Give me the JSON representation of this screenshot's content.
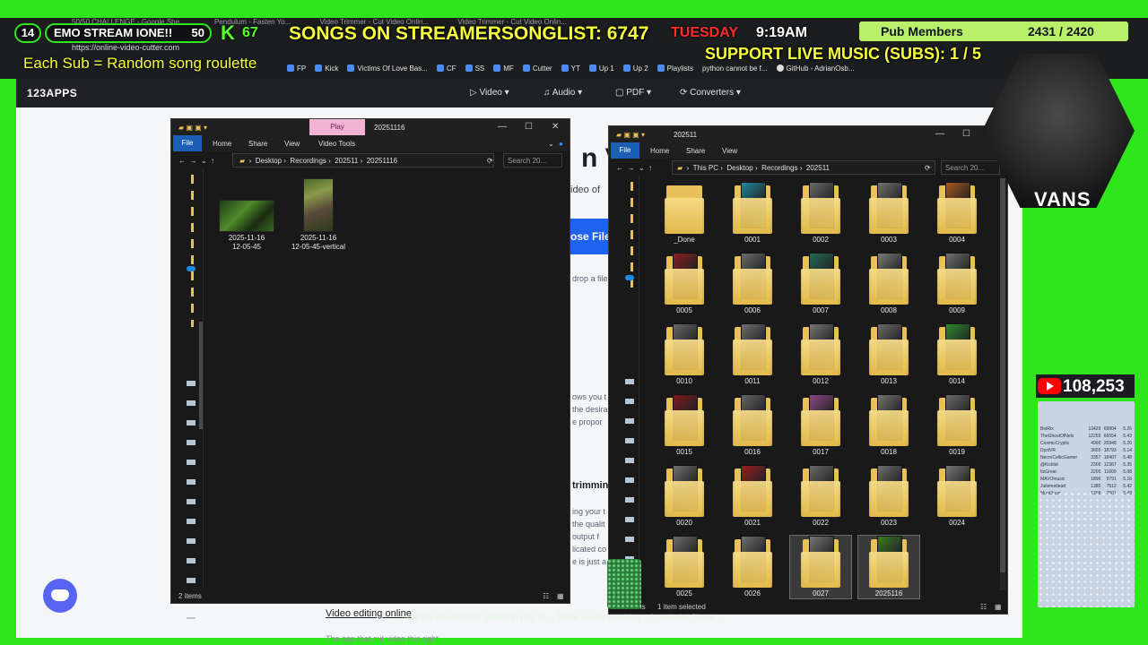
{
  "overlay": {
    "tabs": [
      "50/50 CHALLENGE - Google She...",
      "Pendulum - Fasten Yo...",
      "Video Trimmer - Cut Video Onlin...",
      "Video Trimmer - Cut Video Onlin..."
    ],
    "url": "https://online-video-cutter.com",
    "left_badge_num": "14",
    "emo_badge": "EMO STREAM IONE!!",
    "right_badge_num": "50",
    "kick_count": "67",
    "songs_text": "SONGS ON STREAMERSONGLIST: 6747",
    "day_text": "TUESDAY",
    "time_text": "9:19AM",
    "pub_label": "Pub Members",
    "pub_count": "2431 / 2420",
    "support_text": "SUPPORT LIVE MUSIC (SUBS): 1 / 5",
    "sub_banner": "Each Sub = Random song roulette",
    "bookmarks": [
      "FP",
      "Kick",
      "Victims Of Love Bas...",
      "CF",
      "SS",
      "MF",
      "Cutter",
      "YT",
      "Up 1",
      "Up 2",
      "Playlists",
      "python cannot be f...",
      "GitHub - AdrianOsb..."
    ],
    "yt_count": "108,253",
    "cam_brand": "VANS",
    "ticker": "...have the winner list for playlist to play :D ... Thank you for watching ... I can help! Check ..."
  },
  "webpage": {
    "logo": "123APPS",
    "nav": [
      {
        "label": "Video",
        "icon": "video-icon"
      },
      {
        "label": "Audio",
        "icon": "music-note-icon"
      },
      {
        "label": "PDF",
        "icon": "document-icon"
      },
      {
        "label": "Converters",
        "icon": "refresh-icon"
      }
    ],
    "choose_btn": "ose File",
    "hero_fragment": "n Vi",
    "sub_fragment": "ideo of",
    "drop_fragment": "drop a file",
    "para_fragments": [
      "ows you t",
      "the desira",
      "e propor"
    ],
    "section_fragment": "trimmin",
    "section_lines": [
      "ing your t",
      "the qualit",
      "output f",
      "licated co",
      "e is just a"
    ],
    "tagline": "Video editing online",
    "tagline_sub": "The app that cut video this right"
  },
  "left_window": {
    "play_tab": "Play",
    "title": "20251116",
    "ribbon": [
      "File",
      "Home",
      "Share",
      "View",
      "Video Tools"
    ],
    "path": [
      "Desktop",
      "Recordings",
      "202511",
      "20251116"
    ],
    "search_placeholder": "Search 20...",
    "items": [
      {
        "label": "2025-11-16\n12-05-45",
        "kind": "video-h"
      },
      {
        "label": "2025-11-16\n12-05-45-vertical",
        "kind": "video-v"
      }
    ],
    "status": "2 items"
  },
  "right_window": {
    "title": "202511",
    "ribbon": [
      "File",
      "Home",
      "Share",
      "View"
    ],
    "path": [
      "This PC",
      "Desktop",
      "Recordings",
      "202511"
    ],
    "search_placeholder": "Search 20...",
    "status_left": "ms",
    "status": "1 item selected",
    "folders": [
      {
        "label": "_Done",
        "color": ""
      },
      {
        "label": "0001",
        "color": "#1e8a9a"
      },
      {
        "label": "0002",
        "color": "#6a6a6a"
      },
      {
        "label": "0003",
        "color": "#737373"
      },
      {
        "label": "0004",
        "color": "#a8591f"
      },
      {
        "label": "0005",
        "color": "#8a1e22"
      },
      {
        "label": "0006",
        "color": "#6d6d6d"
      },
      {
        "label": "0007",
        "color": "#1f6d55"
      },
      {
        "label": "0008",
        "color": "#7c7c7c"
      },
      {
        "label": "0009",
        "color": "#707070"
      },
      {
        "label": "0010",
        "color": "#686868"
      },
      {
        "label": "0011",
        "color": "#6f6f6f"
      },
      {
        "label": "0012",
        "color": "#777777"
      },
      {
        "label": "0013",
        "color": "#6a6a6a"
      },
      {
        "label": "0014",
        "color": "#2d8a2f"
      },
      {
        "label": "0015",
        "color": "#7d1a1f"
      },
      {
        "label": "0016",
        "color": "#666666"
      },
      {
        "label": "0017",
        "color": "#8e4a8a"
      },
      {
        "label": "0018",
        "color": "#747474"
      },
      {
        "label": "0019",
        "color": "#6b6b6b"
      },
      {
        "label": "0020",
        "color": "#707070"
      },
      {
        "label": "0021",
        "color": "#9a1b20"
      },
      {
        "label": "0022",
        "color": "#6b6b6b"
      },
      {
        "label": "0023",
        "color": "#6e6e6e"
      },
      {
        "label": "0024",
        "color": "#767676"
      },
      {
        "label": "0025",
        "color": "#6c6c6c"
      },
      {
        "label": "0026",
        "color": "#707070"
      },
      {
        "label": "0027",
        "color": "#777777"
      },
      {
        "label": "2025116",
        "color": "#3c7a25"
      }
    ],
    "selected_index": 28,
    "hover_index": 27
  },
  "leaderboard": [
    {
      "name": "BotRix",
      "a": "13429",
      "b": "69804",
      "c": "5.26"
    },
    {
      "name": "TheGhostOfNels",
      "a": "12255",
      "b": "66554",
      "c": "5.43"
    },
    {
      "name": "CosmicCryptic",
      "a": "4990",
      "b": "25948",
      "c": "5.20"
    },
    {
      "name": "DystVR",
      "a": "3655",
      "b": "18793",
      "c": "5.14"
    },
    {
      "name": "NecroCelticGamer",
      "a": "3357",
      "b": "18407",
      "c": "5.48"
    },
    {
      "name": "@Kicklet",
      "a": "2309",
      "b": "12367",
      "c": "5.35"
    },
    {
      "name": "ItzGreat",
      "a": "2205",
      "b": "11609",
      "c": "5.08"
    },
    {
      "name": "MAVOmusic",
      "a": "1896",
      "b": "9791",
      "c": "5.16"
    },
    {
      "name": "Julietnetlead",
      "a": "1385",
      "b": "7512",
      "c": "5.42"
    },
    {
      "name": "Murd3rcat",
      "a": "1398",
      "b": "7501",
      "c": "5.48"
    }
  ]
}
